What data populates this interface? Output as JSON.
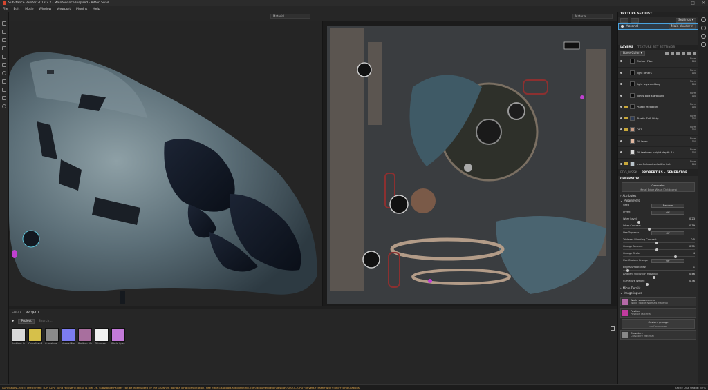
{
  "window": {
    "title": "Substance Painter 2018.2.2 - Maintenance Inspired - Riften Snail",
    "controls": [
      "—",
      "□",
      "✕"
    ]
  },
  "menu": [
    "File",
    "Edit",
    "Mode",
    "Window",
    "Viewport",
    "Plugins",
    "Help"
  ],
  "viewport": {
    "left_material": "Material",
    "right_material": "Material"
  },
  "texture_set_list": {
    "title": "TEXTURE SET LIST",
    "settings_label": "Settings ▾",
    "material_name": "Material",
    "shader": "Main shader ▾"
  },
  "layers_panel": {
    "tab_layers": "LAYERS",
    "tab_settings": "TEXTURE SET SETTINGS",
    "channel_select": "Base Color ▾",
    "layers": [
      {
        "name": "Carbon Fiber",
        "blend": "Norm",
        "opacity": "100",
        "thumb": "#0a0a0a",
        "folder": false
      },
      {
        "name": "light others",
        "blend": "Norm",
        "opacity": "100",
        "thumb": "#0a0a0a",
        "folder": false
      },
      {
        "name": "light legs and bay",
        "blend": "Norm",
        "opacity": "100",
        "thumb": "#0a0a0a",
        "folder": false
      },
      {
        "name": "lights port starboard",
        "blend": "Norm",
        "opacity": "100",
        "thumb": "#0a0a0a",
        "folder": false
      },
      {
        "name": "Plastic Hexagon",
        "blend": "Norm",
        "opacity": "100",
        "thumb": "#121212",
        "folder": true
      },
      {
        "name": "Plastic Soft Dirty",
        "blend": "Norm",
        "opacity": "100",
        "thumb": "#2c3a55",
        "folder": true
      },
      {
        "name": "DET",
        "blend": "Norm",
        "opacity": "100",
        "thumb": "#c99a82",
        "folder": true
      },
      {
        "name": "Fill layer",
        "blend": "Norm",
        "opacity": "100",
        "thumb": "#e0b8a0",
        "folder": false
      },
      {
        "name": "Fill features height depth 4 t...",
        "blend": "Norm",
        "opacity": "100",
        "thumb": "#d8d8d8",
        "folder": false
      },
      {
        "name": "Iron Galvanized with rivet",
        "blend": "Norm",
        "opacity": "100",
        "thumb": "#b9c4cc",
        "folder": true
      }
    ]
  },
  "properties": {
    "tab_left": "EDG_MSSK",
    "tab_title": "PROPERTIES - GENERATOR",
    "section_generator": "GENERATOR",
    "generator_label": "Generator",
    "generator_value": "Metal Edge Wear (Outdoors)",
    "attributes": "Attributes",
    "parameters": "Parameters",
    "seed_label": "Seed",
    "seed_value": "Random",
    "invert_label": "Invert",
    "invert_value": "Off",
    "sliders": [
      {
        "label": "Wear Level",
        "value": "0.23",
        "frac": 0.23
      },
      {
        "label": "Wear Contrast",
        "value": "0.39",
        "frac": 0.39
      },
      {
        "label": "Use Tripleser",
        "value": "Off",
        "button": true
      },
      {
        "label": "Tripleser Blending Contrast",
        "value": "0.5",
        "frac": 0.5
      },
      {
        "label": "Grunge Amount",
        "value": "0.51",
        "frac": 0.51
      },
      {
        "label": "Grunge Scale",
        "value": "4",
        "frac": 0.8
      },
      {
        "label": "Use Custom Grunge",
        "value": "Off",
        "button": true
      },
      {
        "label": "Edges Smoothness",
        "value": "1",
        "frac": 0.05
      },
      {
        "label": "Ambient Occlusion Masking",
        "value": "0.46",
        "frac": 0.46
      },
      {
        "label": "Curvature Weight",
        "value": "0.36",
        "frac": 0.36
      }
    ],
    "micro_details": "Micro Details",
    "image_inputs": "Image inputs",
    "inputs": [
      {
        "title": "World space normal",
        "sub": "World Space Normals Material",
        "color": "#b56aa8"
      },
      {
        "title": "Position",
        "sub": "Position Material",
        "color": "#c23b9f"
      }
    ],
    "custom_grunge": "Custom grunge",
    "custom_grunge_sub": "uniform color",
    "curvature": "Curvature",
    "curvature_sub": "Curvature Material"
  },
  "shelf": {
    "tab_shelf": "SHELF",
    "tab_project": "PROJECT",
    "filter": "Project",
    "search_placeholder": "Search...",
    "items": [
      {
        "label": "Ambient O...",
        "color": "#d9d9d9"
      },
      {
        "label": "Color Map F...",
        "color": "#d6c04a"
      },
      {
        "label": "Curvature...",
        "color": "#8a8a8a"
      },
      {
        "label": "Normal Ma...",
        "color": "#7c7cf0"
      },
      {
        "label": "Position Ma...",
        "color": "#a86f9e"
      },
      {
        "label": "Thickness...",
        "color": "#f0f0f0"
      },
      {
        "label": "World Spac...",
        "color": "#c37ad8"
      }
    ]
  },
  "status": {
    "message": "[GPUIssuesCheck] The current TDR (GPU hang recovery) delay is low: 2s. Substance Painter can be interrupted by the OS when doing a long computation. See https://support.allegorithmic.com/documentation/display/SPDOC/GPU+drivers+crash+with+long+computations",
    "cache": "Cache Disk Usage:  57%"
  },
  "colors": {
    "accent": "#4aa3df",
    "warning": "#e0a64a"
  }
}
